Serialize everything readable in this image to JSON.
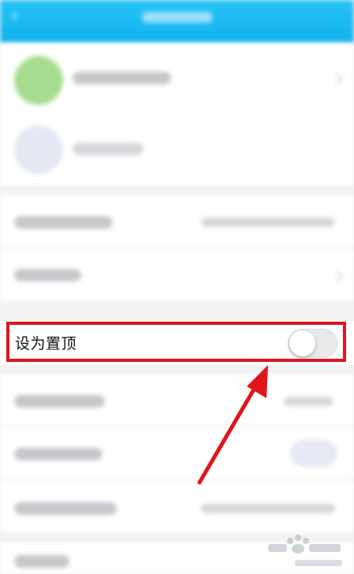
{
  "settings": {
    "pin_label": "设为置顶",
    "pin_enabled": false
  },
  "colors": {
    "header": "#12b1ee",
    "highlight": "#e0141b",
    "toggle_off": "#e9e9ec"
  },
  "icons": [
    "back-icon",
    "chevron-right-icon",
    "arrow-annotation-icon"
  ]
}
